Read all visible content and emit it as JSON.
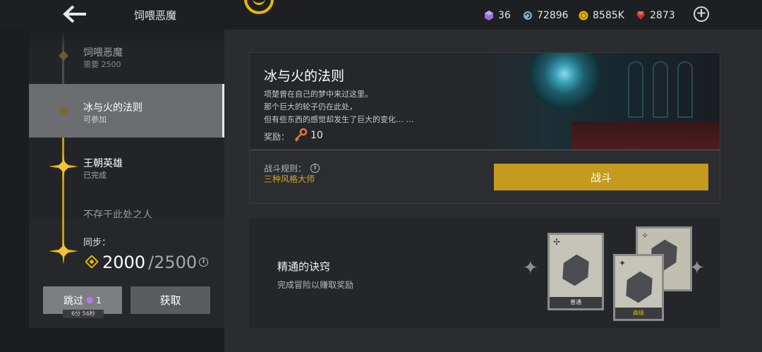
{
  "header": {
    "title": "饲喂恶魔",
    "currencies": [
      {
        "name": "gem",
        "value": "36",
        "color": "#9b6fd6"
      },
      {
        "name": "swirl",
        "value": "72896",
        "color": "#7fb0c4"
      },
      {
        "name": "coin",
        "value": "8585K",
        "color": "#e6b800"
      },
      {
        "name": "ruby",
        "value": "2873",
        "color": "#c0392b"
      }
    ]
  },
  "stages": [
    {
      "name": "饲喂恶魔",
      "sub": "需要 2500"
    },
    {
      "name": "冰与火的法则",
      "sub": "可参加"
    },
    {
      "name": "王朝英雄",
      "sub": "已完成"
    },
    {
      "name": "不存于此处之人",
      "sub": ""
    }
  ],
  "sync": {
    "label": "同步：",
    "current": "2000",
    "total": "/2500"
  },
  "buttons": {
    "skip": "跳过",
    "skip_cost": "1",
    "skip_timer": "6分 56秒",
    "get": "获取",
    "fight": "战斗"
  },
  "mission": {
    "title": "冰与火的法则",
    "desc": [
      "项楚曾在自己的梦中来过这里。",
      "那个巨大的轮子仍在此处，",
      "但有些东西的感觉却发生了巨大的变化… …"
    ],
    "reward_label": "奖励：",
    "reward_value": "10",
    "rules_label": "战斗规则：",
    "rules_value": "三种风格大师"
  },
  "mastery": {
    "title": "精通的诀窍",
    "sub": "完成冒险以赚取奖励",
    "cards": [
      "普通",
      "高级"
    ]
  },
  "colors": {
    "accent_gold": "#c49a1f",
    "selected_bg": "#6b6d70"
  }
}
